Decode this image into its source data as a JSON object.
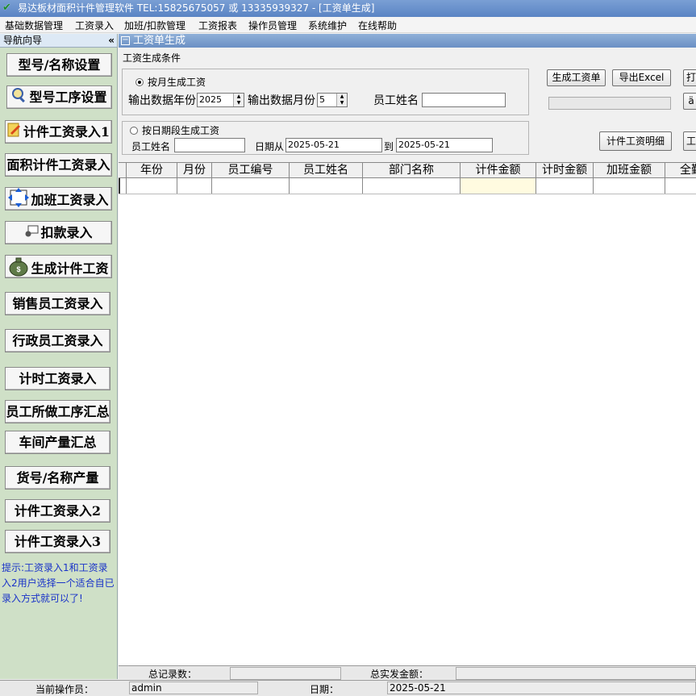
{
  "window": {
    "title": "易达板材面积计件管理软件  TEL:15825675057 或 13335939327  - [工资单生成]"
  },
  "menu": [
    "基础数据管理",
    "工资录入",
    "加班/扣款管理",
    "工资报表",
    "操作员管理",
    "系统维护",
    "在线帮助"
  ],
  "nav": {
    "header": "导航向导",
    "collapse": "«",
    "buttons": [
      "型号/名称设置",
      "型号工序设置",
      "计件工资录入1",
      "面积计件工资录入",
      "加班工资录入",
      "扣款录入",
      "生成计件工资",
      "销售员工资录入",
      "行政员工资录入",
      "计时工资录入",
      "员工所做工序汇总",
      "车间产量汇总",
      "货号/名称产量",
      "计件工资录入2",
      "计件工资录入3"
    ],
    "hint": "提示:工资录入1和工资录入2用户选择一个适合自已录入方式就可以了!"
  },
  "panel": {
    "title": "工资单生成",
    "conditions_legend": "工资生成条件",
    "by_month": {
      "label": "按月生成工资",
      "year_label": "输出数据年份",
      "year_value": "2025",
      "month_label": "输出数据月份",
      "month_value": "5",
      "name_label": "员工姓名",
      "name_value": ""
    },
    "by_date": {
      "label": "按日期段生成工资",
      "name_label": "员工姓名",
      "name_value": "",
      "from_label": "日期从",
      "from_value": "2025-05-21",
      "to_label": "到",
      "to_value": "2025-05-21"
    },
    "buttons": {
      "generate": "生成工资单",
      "export": "导出Excel",
      "print_partial": "打",
      "detail": "计件工资明细",
      "right_partial": "工",
      "mid_partial": "ä"
    }
  },
  "grid": {
    "columns": [
      "年份",
      "月份",
      "员工编号",
      "员工姓名",
      "部门名称",
      "计件金额",
      "计时金额",
      "加班金额",
      "全勤"
    ],
    "rows": []
  },
  "summary": {
    "total_records_label": "总记录数：",
    "total_records_value": "",
    "total_paid_label": "总实发金额：",
    "total_paid_value": ""
  },
  "status": {
    "operator_label": "当前操作员：",
    "operator_value": "admin",
    "date_label": "日期：",
    "date_value": "2025-05-21"
  }
}
